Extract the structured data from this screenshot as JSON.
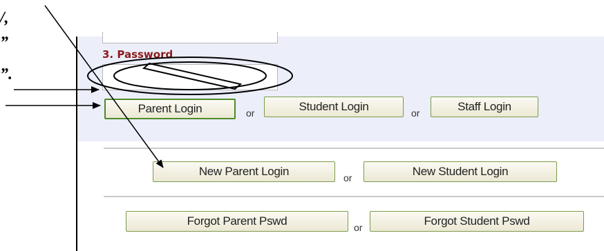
{
  "form": {
    "password_label": "3. Password"
  },
  "login_buttons": {
    "parent": "Parent Login",
    "student": "Student Login",
    "staff": "Staff Login"
  },
  "new_buttons": {
    "parent": "New Parent Login",
    "student": "New Student Login"
  },
  "forgot_buttons": {
    "parent": "Forgot Parent Pswd",
    "student": "Forgot Student Pswd"
  },
  "separator_text": "or",
  "colors": {
    "panel_bg": "#eceefa",
    "label_color": "#8b1a1a",
    "button_border": "#7a9a4a"
  }
}
